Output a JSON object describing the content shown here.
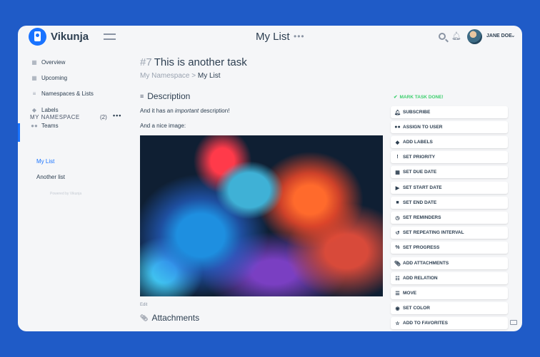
{
  "app": {
    "name": "Vikunja"
  },
  "header": {
    "title": "My List",
    "menu_dots": "•••",
    "user_name": "JANE DOE",
    "user_menu_icon": "chevron-down-icon"
  },
  "sidebar": {
    "items": [
      {
        "label": "Overview",
        "icon": "calendar-icon"
      },
      {
        "label": "Upcoming",
        "icon": "calendar-icon"
      },
      {
        "label": "Namespaces & Lists",
        "icon": "layers-icon"
      },
      {
        "label": "Labels",
        "icon": "tags-icon"
      },
      {
        "label": "Teams",
        "icon": "users-icon"
      }
    ],
    "namespace": {
      "title": "MY NAMESPACE",
      "count": "(2)",
      "menu_dots": "•••"
    },
    "lists": [
      {
        "label": "My List",
        "active": true
      },
      {
        "label": "Another list",
        "active": false
      }
    ],
    "powered_by": "Powered by Vikunja"
  },
  "task": {
    "number": "#7",
    "title": "This is another task",
    "breadcrumb_namespace": "My Namespace",
    "breadcrumb_separator": ">",
    "breadcrumb_list": "My List",
    "description_heading": "Description",
    "desc_line1_before": "And it has an ",
    "desc_line1_em": "important",
    "desc_line1_after": " description!",
    "desc_line2": "And a nice image:",
    "edit_label": "Edit",
    "attachments_heading": "Attachments"
  },
  "actions": {
    "mark_done": "MARK TASK DONE!",
    "buttons": [
      {
        "label": "SUBSCRIBE",
        "icon": "bell-icon"
      },
      {
        "label": "ASSIGN TO USER",
        "icon": "users-icon"
      },
      {
        "label": "ADD LABELS",
        "icon": "tags-icon"
      },
      {
        "label": "SET PRIORITY",
        "icon": "exclamation-icon"
      },
      {
        "label": "SET DUE DATE",
        "icon": "calendar-icon"
      },
      {
        "label": "SET START DATE",
        "icon": "play-icon"
      },
      {
        "label": "SET END DATE",
        "icon": "stop-icon"
      },
      {
        "label": "SET REMINDERS",
        "icon": "clock-icon"
      },
      {
        "label": "SET REPEATING INTERVAL",
        "icon": "history-icon"
      },
      {
        "label": "SET PROGRESS",
        "icon": "percent-icon"
      },
      {
        "label": "ADD ATTACHMENTS",
        "icon": "paperclip-icon"
      },
      {
        "label": "ADD RELATION",
        "icon": "sitemap-icon"
      },
      {
        "label": "MOVE",
        "icon": "list-icon"
      },
      {
        "label": "SET COLOR",
        "icon": "fill-drip-icon"
      },
      {
        "label": "ADD TO FAVORITES",
        "icon": "star-icon"
      }
    ]
  },
  "colors": {
    "background": "#1f5bc7",
    "accent": "#1973ff",
    "success": "#3ecf6e",
    "text": "#2c3e50"
  }
}
